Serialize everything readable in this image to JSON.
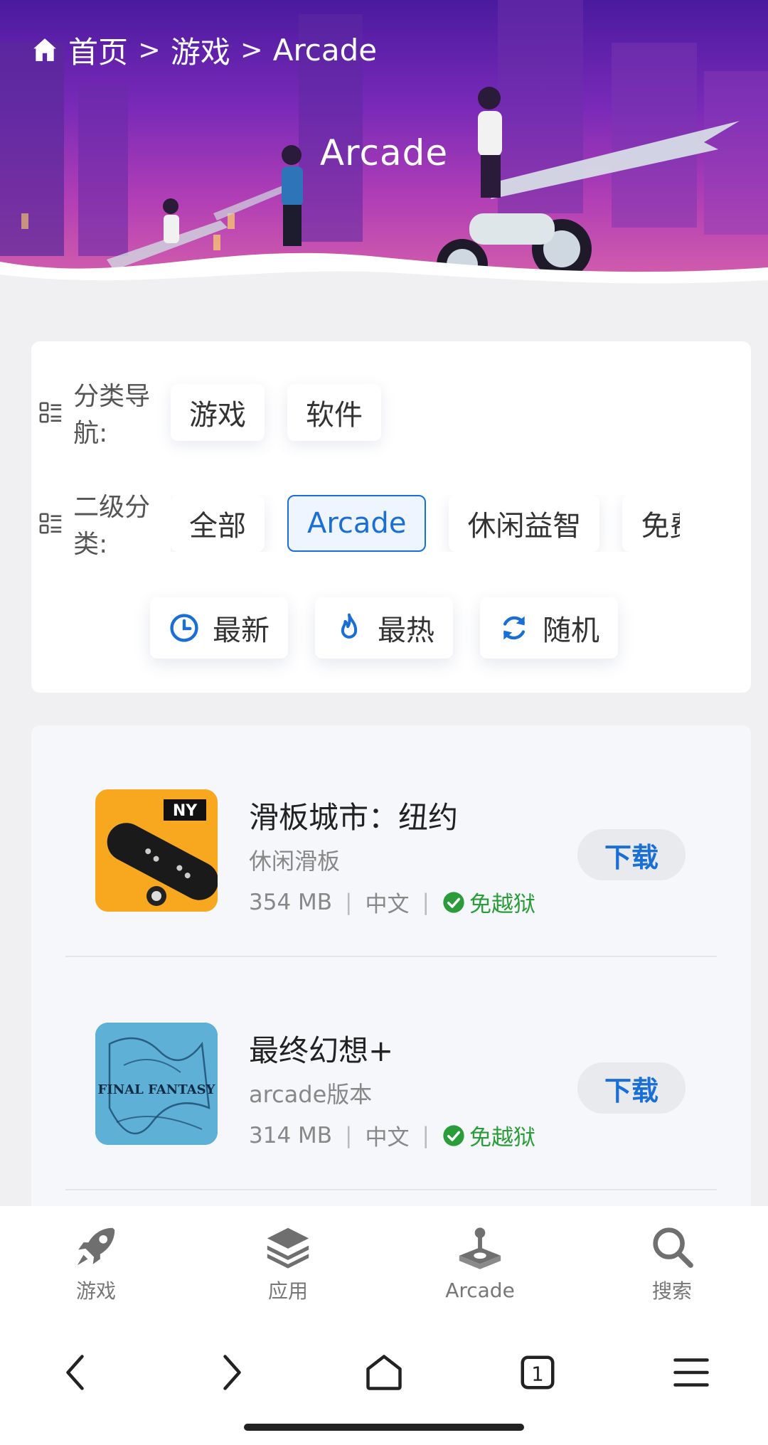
{
  "breadcrumb": {
    "home": "首页",
    "sep1": ">",
    "level1": "游戏",
    "sep2": ">",
    "level2": "Arcade"
  },
  "hero": {
    "title": "Arcade"
  },
  "filters": {
    "category_label": "分类导航:",
    "category_chips": [
      "游戏",
      "软件"
    ],
    "sub_label": "二级分类:",
    "sub_chips": [
      "全部",
      "Arcade",
      "休闲益智",
      "免费"
    ],
    "sub_active": "Arcade",
    "sort": {
      "newest": "最新",
      "hottest": "最热",
      "random": "随机"
    }
  },
  "colors": {
    "accent": "#1a6fd6",
    "jailbreak": "#2a9d3a"
  },
  "apps": [
    {
      "name": "滑板城市：纽约",
      "subtitle": "休闲滑板",
      "size": "354 MB",
      "lang": "中文",
      "badge": "免越狱",
      "button": "下载",
      "icon_text": "NY"
    },
    {
      "name": "最终幻想+",
      "subtitle": "arcade版本",
      "size": "314 MB",
      "lang": "中文",
      "badge": "免越狱",
      "button": "下载",
      "icon_text": "FINAL FANTASY"
    }
  ],
  "meta_sep": "|",
  "tabbar": {
    "games": "游戏",
    "apps": "应用",
    "arcade": "Arcade",
    "search": "搜索"
  },
  "browser": {
    "tab_count": "1"
  }
}
